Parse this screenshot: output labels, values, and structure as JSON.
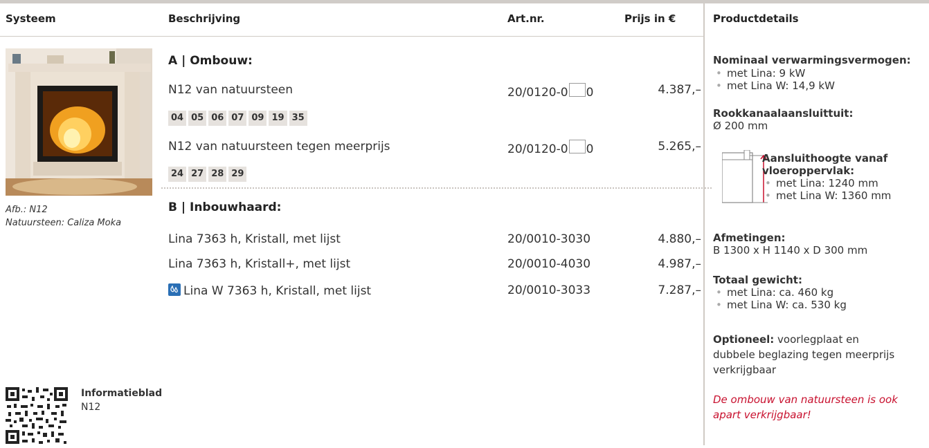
{
  "header": {
    "col_system": "Systeem",
    "col_description": "Beschrijving",
    "col_artnr": "Art.nr.",
    "col_price": "Prijs in €",
    "col_details": "Productdetails"
  },
  "product": {
    "caption_line1": "Afb.: N12",
    "caption_line2": "Natuursteen: Caliza Moka"
  },
  "section_a": {
    "title": "A | Ombouw:",
    "rows": [
      {
        "desc": "N12 van natuursteen",
        "art_prefix": "20/0120-0",
        "art_suffix": "0",
        "price": "4.387,–"
      },
      {
        "desc": "N12 van natuursteen tegen meerprijs",
        "art_prefix": "20/0120-0",
        "art_suffix": "0",
        "price": "5.265,–"
      }
    ],
    "codes_1": [
      "04",
      "05",
      "06",
      "07",
      "09",
      "19",
      "35"
    ],
    "codes_2": [
      "24",
      "27",
      "28",
      "29"
    ]
  },
  "section_b": {
    "title": "B | Inbouwhaard:",
    "rows": [
      {
        "desc": "Lina 7363 h, Kristall, met lijst",
        "art": "20/0010-3030",
        "price": "4.880,–"
      },
      {
        "desc": "Lina 7363 h, Kristall+, met lijst",
        "art": "20/0010-4030",
        "price": "4.987,–"
      },
      {
        "desc": "Lina W 7363 h, Kristall, met lijst",
        "art": "20/0010-3033",
        "price": "7.287,–",
        "icon": "water-heating-icon"
      }
    ]
  },
  "info_sheet": {
    "title": "Informatieblad",
    "subtitle": "N12"
  },
  "details": {
    "heating_title": "Nominaal verwarmingsvermogen:",
    "heating_items": [
      "met Lina: 9 kW",
      "met Lina W: 14,9 kW"
    ],
    "flue_title": "Rookkanaalaansluittuit:",
    "flue_value": "Ø 200 mm",
    "height_title_line1": "Aansluithoogte vanaf",
    "height_title_line2": "vloeroppervlak:",
    "height_items": [
      "met Lina: 1240 mm",
      "met Lina W: 1360 mm"
    ],
    "dimensions_title": "Afmetingen:",
    "dimensions_value": "B 1300 x H 1140 x D 300 mm",
    "weight_title": "Totaal gewicht:",
    "weight_items": [
      "met Lina: ca. 460 kg",
      "met Lina W: ca. 530 kg"
    ],
    "optional_label": "Optioneel:",
    "optional_text_1": " voorlegplaat en",
    "optional_text_2": "dubbele beglazing tegen meerprijs",
    "optional_text_3": "verkrijgbaar",
    "note_line1": "De ombouw van natuursteen is ook",
    "note_line2": "apart verkrijgbaar!"
  },
  "colors": {
    "accent_red": "#c8102e",
    "water_icon_blue": "#2a6fb5",
    "code_bg": "#e6e2de"
  }
}
